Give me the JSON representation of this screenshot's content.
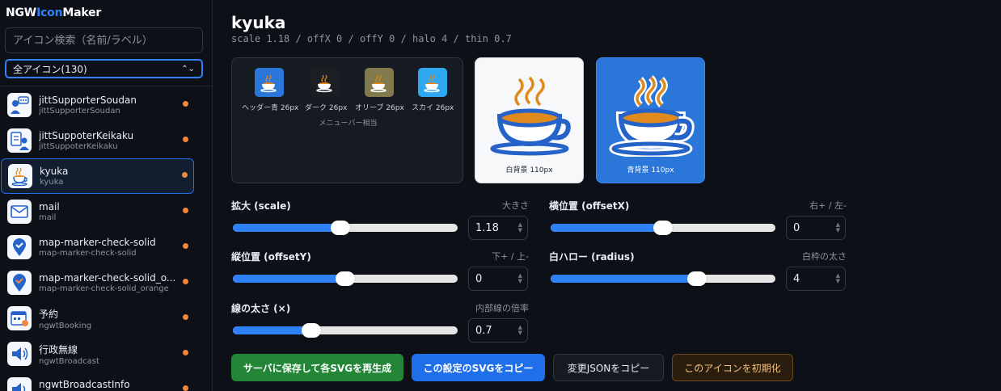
{
  "app": {
    "brand_a": "NGW",
    "brand_b": "Icon",
    "brand_c": "Maker"
  },
  "sidebar": {
    "search_placeholder": "アイコン検索（名前/ラベル）",
    "filter_selected": "全アイコン(130)",
    "items": [
      {
        "name": "jittSupporterSoudan",
        "id": "jittSupporterSoudan",
        "icon": "person-chat-icon"
      },
      {
        "name": "jittSuppoterKeikaku",
        "id": "jittSuppoterKeikaku",
        "icon": "person-clipboard-icon"
      },
      {
        "name": "kyuka",
        "id": "kyuka",
        "icon": "coffee-cup-icon",
        "active": true
      },
      {
        "name": "mail",
        "id": "mail",
        "icon": "envelope-icon"
      },
      {
        "name": "map-marker-check-solid",
        "id": "map-marker-check-solid",
        "icon": "map-marker-check-icon"
      },
      {
        "name": "map-marker-check-solid_o...",
        "id": "map-marker-check-solid_orange",
        "icon": "map-marker-check-orange-icon"
      },
      {
        "name": "予約",
        "id": "ngwtBooking",
        "icon": "calendar-person-icon"
      },
      {
        "name": "行政無線",
        "id": "ngwtBroadcast",
        "icon": "speaker-icon"
      },
      {
        "name": "ngwtBroadcastInfo",
        "id": "ngwtBroadcastInfo",
        "icon": "speaker-info-icon"
      }
    ]
  },
  "main": {
    "title": "kyuka",
    "subtitle": "scale 1.18 / offX 0 / offY 0 / halo 4 / thin 0.7",
    "small_previews": [
      {
        "label": "ヘッダー青 26px",
        "bg": "#2b77d9"
      },
      {
        "label": "ダーク 26px",
        "bg": "#1b1f24"
      },
      {
        "label": "オリーブ 26px",
        "bg": "#807a4e"
      },
      {
        "label": "スカイ 26px",
        "bg": "#2ea8f0"
      }
    ],
    "small_caption": "メニューバー相当",
    "big_white_caption": "白背景 110px",
    "big_blue_caption": "青背景 110px"
  },
  "controls": {
    "scale": {
      "label": "拡大 (scale)",
      "hint": "大きさ",
      "value": "1.18",
      "fraction": 0.48
    },
    "offset_x": {
      "label": "横位置 (offsetX)",
      "hint": "右+ / 左-",
      "value": "0",
      "fraction": 0.5
    },
    "offset_y": {
      "label": "縦位置 (offsetY)",
      "hint": "下+ / 上-",
      "value": "0",
      "fraction": 0.5
    },
    "halo": {
      "label": "白ハロー (radius)",
      "hint": "白枠の太さ",
      "value": "4",
      "fraction": 0.65
    },
    "thin": {
      "label": "線の太さ (×)",
      "hint": "内部線の倍率",
      "value": "0.7",
      "fraction": 0.35
    }
  },
  "buttons": {
    "save": "サーバに保存して各SVGを再生成",
    "copy_svg": "この設定のSVGをコピー",
    "copy_json": "変更JSONをコピー",
    "reset": "このアイコンを初期化"
  },
  "colors": {
    "accent": "#2f81f7",
    "dot": "#f0883e",
    "save": "#238636"
  }
}
